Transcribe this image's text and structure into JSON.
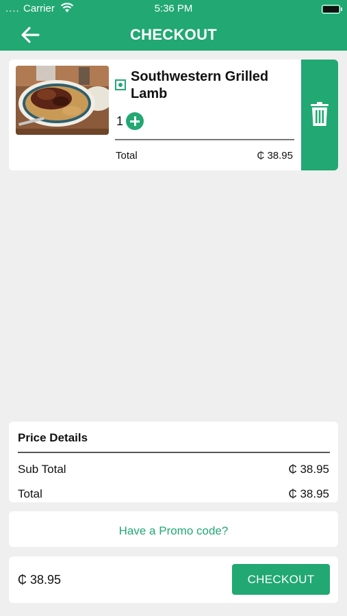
{
  "status_bar": {
    "carrier": "Carrier",
    "time": "5:36 PM"
  },
  "header": {
    "title": "CHECKOUT",
    "back_icon": "arrow-left-icon"
  },
  "cart_item": {
    "name": "Southwestern Grilled Lamb",
    "quantity": "1",
    "total_label": "Total",
    "total_value": "₵ 38.95",
    "veg_icon": "veg-indicator-icon",
    "delete_icon": "trash-icon"
  },
  "price_details": {
    "title": "Price Details",
    "subtotal_label": "Sub Total",
    "subtotal_value": "₵ 38.95",
    "total_label": "Total",
    "total_value": "₵ 38.95"
  },
  "promo": {
    "label": "Have a Promo code?"
  },
  "footer": {
    "amount": "₵ 38.95",
    "checkout_label": "CHECKOUT"
  },
  "colors": {
    "accent": "#22a873",
    "background": "#efefef"
  }
}
